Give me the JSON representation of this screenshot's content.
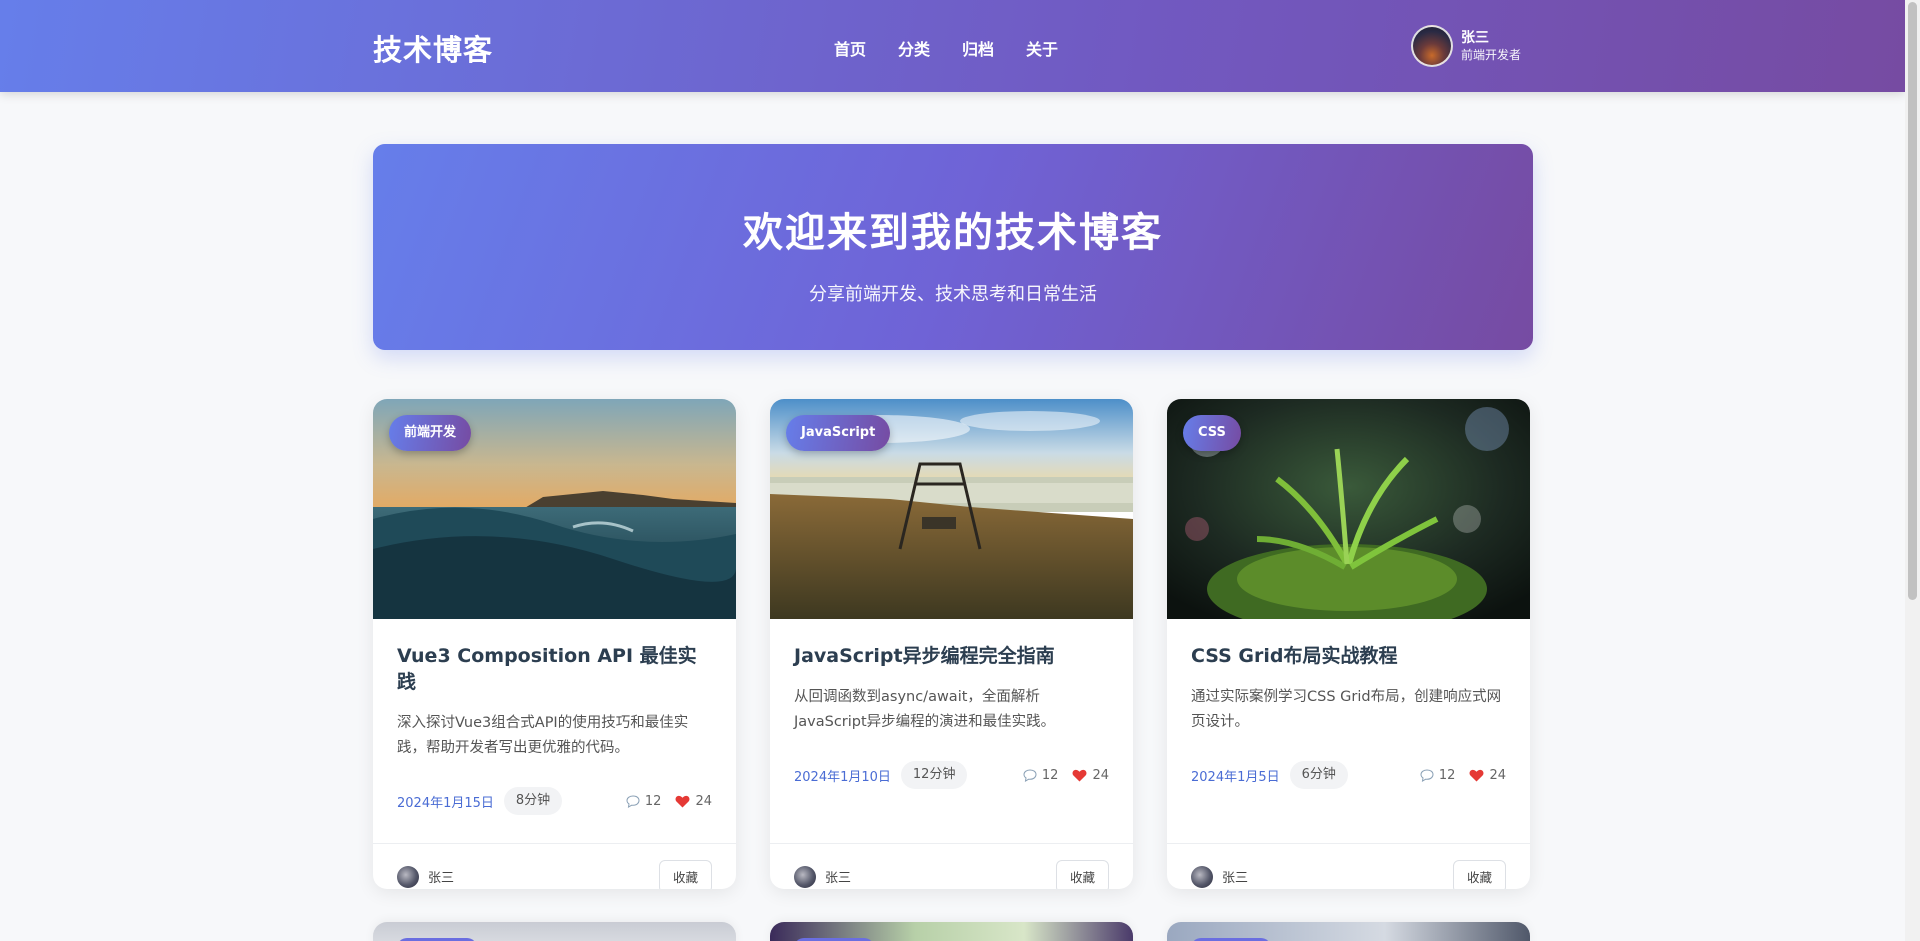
{
  "header": {
    "logo": "技术博客",
    "nav": [
      "首页",
      "分类",
      "归档",
      "关于"
    ],
    "user": {
      "name": "张三",
      "role": "前端开发者"
    }
  },
  "hero": {
    "title": "欢迎来到我的技术博客",
    "subtitle": "分享前端开发、技术思考和日常生活"
  },
  "posts": [
    {
      "tag": "前端开发",
      "title": "Vue3 Composition API 最佳实践",
      "desc": "深入探讨Vue3组合式API的使用技巧和最佳实践，帮助开发者写出更优雅的代码。",
      "date": "2024年1月15日",
      "read": "8分钟",
      "comments": "12",
      "likes": "24",
      "author": "张三",
      "fav": "收藏"
    },
    {
      "tag": "JavaScript",
      "title": "JavaScript异步编程完全指南",
      "desc": "从回调函数到async/await，全面解析JavaScript异步编程的演进和最佳实践。",
      "date": "2024年1月10日",
      "read": "12分钟",
      "comments": "12",
      "likes": "24",
      "author": "张三",
      "fav": "收藏"
    },
    {
      "tag": "CSS",
      "title": "CSS Grid布局实战教程",
      "desc": "通过实际案例学习CSS Grid布局，创建响应式网页设计。",
      "date": "2024年1月5日",
      "read": "6分钟",
      "comments": "12",
      "likes": "24",
      "author": "张三",
      "fav": "收藏"
    }
  ],
  "icons": {
    "comment": "speech-bubble-icon",
    "like": "heart-icon"
  },
  "colors": {
    "accent": "#667eea",
    "accent2": "#764ba2",
    "date": "#4a6cd4",
    "heart": "#e53935"
  }
}
